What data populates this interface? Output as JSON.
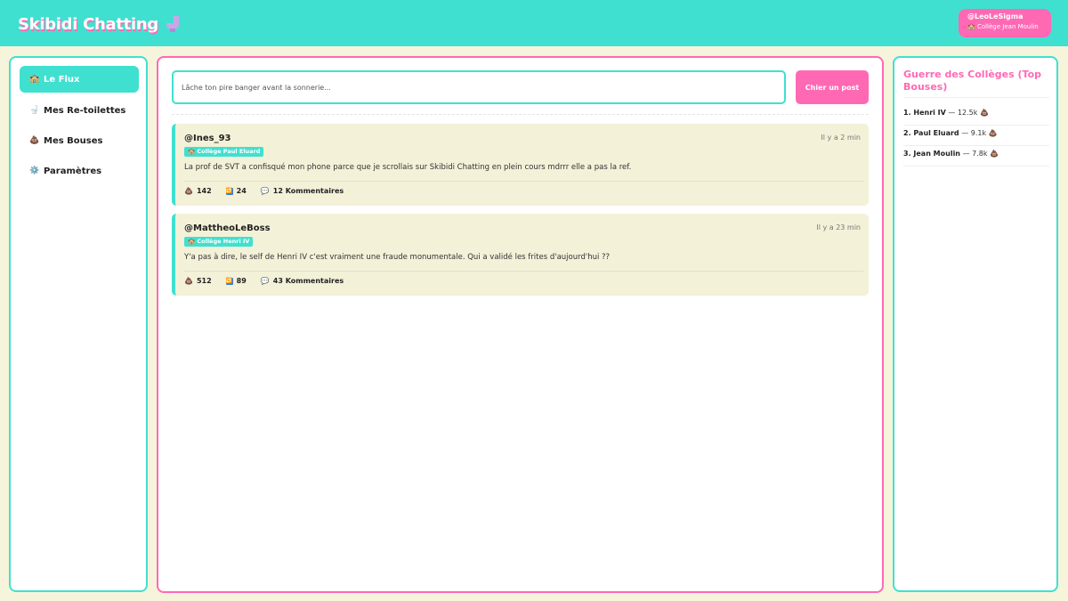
{
  "header": {
    "brand": "Skibidi Chatting",
    "brand_icon": "toilet-icon",
    "user": {
      "handle": "@LeoLeSigma",
      "school": "🏫 Collège Jean Moulin"
    }
  },
  "sidebar": {
    "items": [
      {
        "icon": "🏫",
        "label": "Le Flux",
        "active": true
      },
      {
        "icon": "🚽",
        "label": "Mes Re-toilettes",
        "active": false
      },
      {
        "icon": "💩",
        "label": "Mes Bouses",
        "active": false
      },
      {
        "icon": "⚙️",
        "label": "Paramètres",
        "active": false
      }
    ]
  },
  "composer": {
    "placeholder": "Lâche ton pire banger avant la sonnerie...",
    "button_label": "Chier un post"
  },
  "posts": [
    {
      "author": "@Ines_93",
      "time": "Il y a 2 min",
      "school": "🏫 Collège Paul Eluard",
      "text": "La prof de SVT a confisqué mon phone parce que je scrollais sur Skibidi Chatting en plein cours mdrrr elle a pas la ref.",
      "bouses": "142",
      "reposts": "24",
      "comments": "12 Kommentaires"
    },
    {
      "author": "@MattheoLeBoss",
      "time": "Il y a 23 min",
      "school": "🏫 Collège Henri IV",
      "text": "Y'a pas à dire, le self de Henri IV c'est vraiment une fraude monumentale. Qui a validé les frites d'aujourd'hui ??",
      "bouses": "512",
      "reposts": "89",
      "comments": "43 Kommentaires"
    }
  ],
  "leaderboard": {
    "title": "Guerre des Collèges (Top Bouses)",
    "items": [
      {
        "name": "1. Henri IV",
        "score": "— 12.5k 💩"
      },
      {
        "name": "2. Paul Eluard",
        "score": "— 9.1k 💩"
      },
      {
        "name": "3. Jean Moulin",
        "score": "— 7.8k 💩"
      }
    ]
  },
  "icons": {
    "bouse": "💩",
    "repost": "🔁",
    "comment": "💬"
  },
  "colors": {
    "turquoise": "#40e0d0",
    "pink": "#ff69b4",
    "background": "#f7f4dc",
    "post_background": "#f3f1d8"
  }
}
